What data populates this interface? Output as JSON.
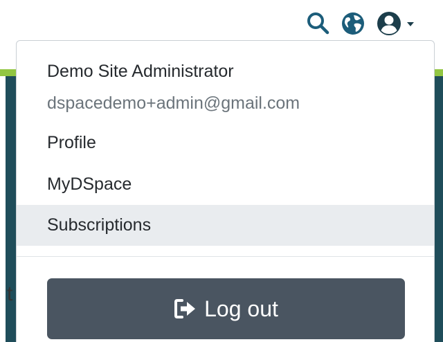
{
  "header": {
    "icons": {
      "search": "search-icon",
      "language": "globe-icon",
      "user": "user-circle-icon",
      "user_caret": "chevron-down-icon"
    },
    "accent_color": "#1c5d7a"
  },
  "user_menu": {
    "name": "Demo Site Administrator",
    "email": "dspacedemo+admin@gmail.com",
    "items": [
      {
        "label": "Profile",
        "active": false
      },
      {
        "label": "MyDSpace",
        "active": false
      },
      {
        "label": "Subscriptions",
        "active": true
      }
    ],
    "logout": {
      "label": "Log out",
      "icon": "sign-out-icon",
      "background": "#4a5561"
    }
  },
  "background_page": {
    "accent_bar_color": "#92c642",
    "band_color": "#1f4d5a",
    "partial_text": "t"
  }
}
